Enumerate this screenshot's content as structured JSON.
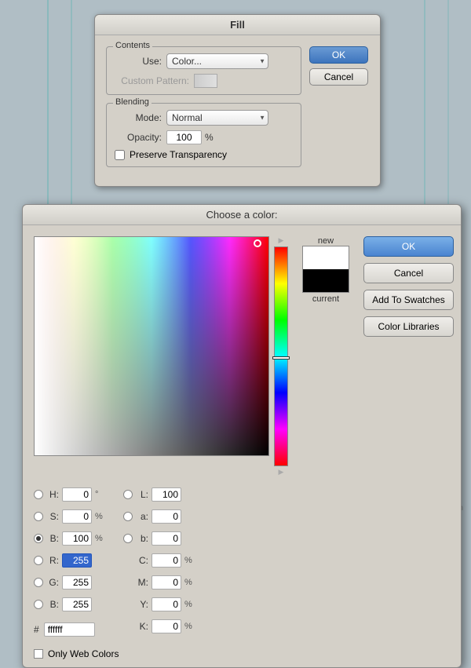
{
  "fill_dialog": {
    "title": "Fill",
    "contents_label": "Contents",
    "use_label": "Use:",
    "use_value": "Color...",
    "custom_pattern_label": "Custom Pattern:",
    "blending_label": "Blending",
    "mode_label": "Mode:",
    "mode_value": "Normal",
    "opacity_label": "Opacity:",
    "opacity_value": "100",
    "opacity_unit": "%",
    "preserve_label": "Preserve Transparency",
    "ok_label": "OK",
    "cancel_label": "Cancel"
  },
  "color_dialog": {
    "title": "Choose a color:",
    "ok_label": "OK",
    "cancel_label": "Cancel",
    "add_swatches_label": "Add To Swatches",
    "color_libraries_label": "Color Libraries",
    "new_label": "new",
    "current_label": "current",
    "h_label": "H:",
    "h_value": "0",
    "h_unit": "°",
    "s_label": "S:",
    "s_value": "0",
    "s_unit": "%",
    "b_label": "B:",
    "b_value": "100",
    "b_unit": "%",
    "r_label": "R:",
    "r_value": "255",
    "g_label": "G:",
    "g_value": "255",
    "b2_label": "B:",
    "b2_value": "255",
    "l_label": "L:",
    "l_value": "100",
    "a_label": "a:",
    "a_value": "0",
    "b3_label": "b:",
    "b3_value": "0",
    "c_label": "C:",
    "c_value": "0",
    "c_unit": "%",
    "m_label": "M:",
    "m_value": "0",
    "m_unit": "%",
    "y_label": "Y:",
    "y_value": "0",
    "y_unit": "%",
    "k_label": "K:",
    "k_value": "0",
    "k_unit": "%",
    "hex_label": "#",
    "hex_value": "ffffff",
    "only_web_colors_label": "Only Web Colors",
    "new_color": "#ffffff",
    "current_color": "#000000"
  },
  "icons": {
    "select_arrow": "▼",
    "triangle": "▶"
  }
}
